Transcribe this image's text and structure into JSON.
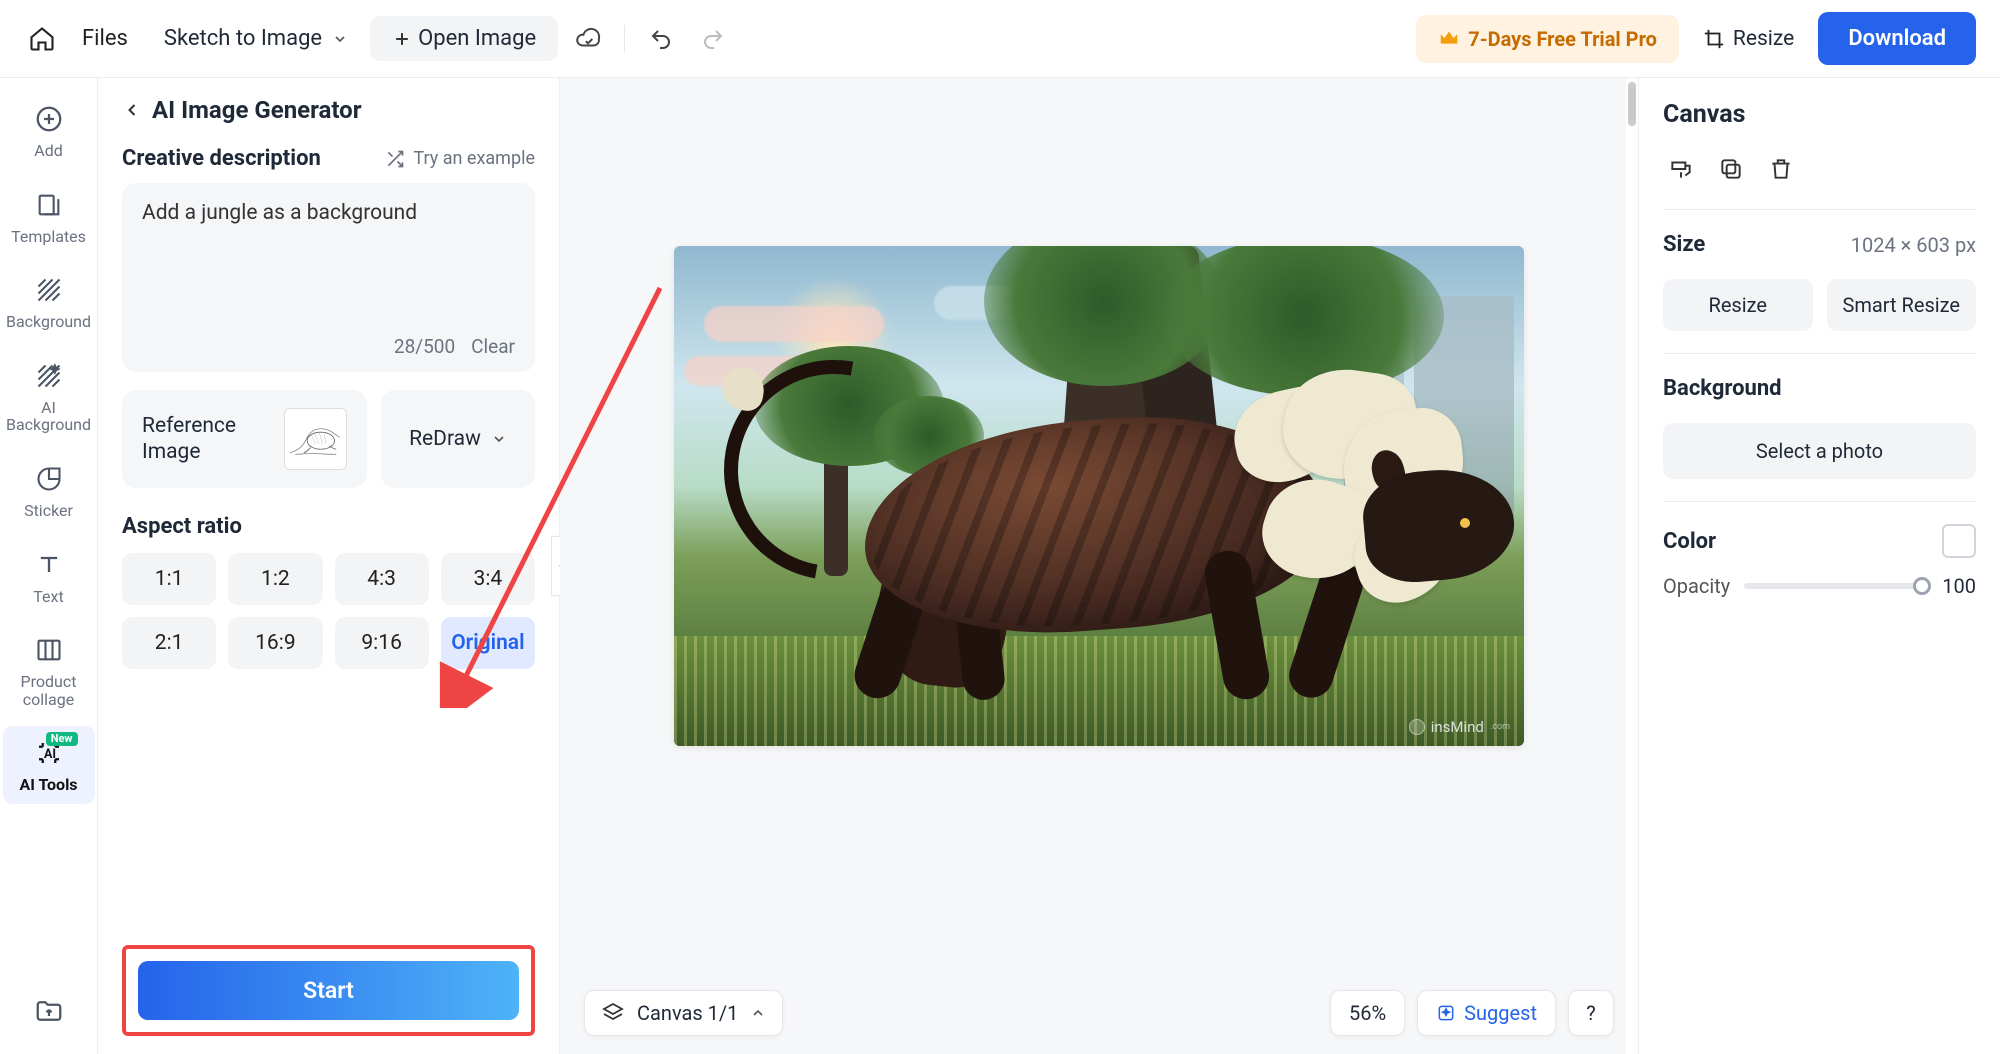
{
  "topbar": {
    "files": "Files",
    "mode": "Sketch to Image",
    "open_image": "Open Image",
    "trial": "7-Days Free Trial  Pro",
    "resize": "Resize",
    "download": "Download"
  },
  "rail": {
    "add": "Add",
    "templates": "Templates",
    "background": "Background",
    "ai_bg": "AI Background",
    "sticker": "Sticker",
    "text": "Text",
    "collage": "Product collage",
    "ai_tools": "AI Tools",
    "badge_new": "New"
  },
  "panel": {
    "title": "AI Image Generator",
    "section_desc": "Creative description",
    "try_example": "Try an example",
    "prompt_value": "Add a jungle as a background",
    "char_count": "28/500",
    "clear": "Clear",
    "reference": "Reference Image",
    "redraw": "ReDraw",
    "aspect_title": "Aspect ratio",
    "aspect": [
      "1:1",
      "1:2",
      "4:3",
      "3:4",
      "2:1",
      "16:9",
      "9:16",
      "Original"
    ],
    "aspect_selected_index": 7,
    "start": "Start"
  },
  "canvas": {
    "layers_label": "Canvas 1/1",
    "zoom": "56%",
    "suggest": "Suggest",
    "help": "?",
    "watermark": "insMind"
  },
  "rpanel": {
    "canvas": "Canvas",
    "size_label": "Size",
    "size_value": "1024 × 603 px",
    "resize": "Resize",
    "smart_resize": "Smart Resize",
    "background": "Background",
    "select_photo": "Select a photo",
    "color": "Color",
    "opacity": "Opacity",
    "opacity_value": "100"
  }
}
